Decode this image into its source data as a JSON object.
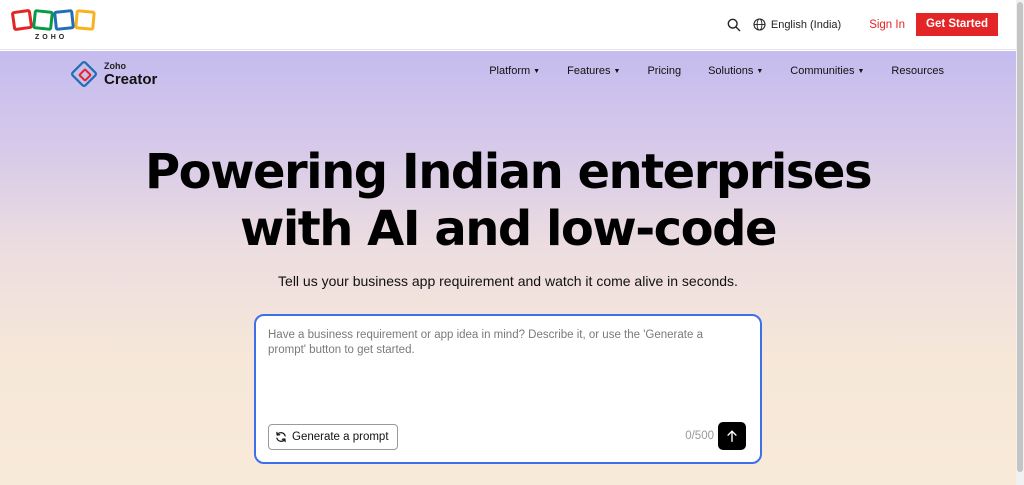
{
  "topbar": {
    "brand_word": "ZOHO",
    "language": "English (India)",
    "sign_in": "Sign In",
    "get_started": "Get Started"
  },
  "product": {
    "small": "Zoho",
    "big": "Creator"
  },
  "nav": {
    "items": [
      {
        "label": "Platform",
        "dropdown": true
      },
      {
        "label": "Features",
        "dropdown": true
      },
      {
        "label": "Pricing",
        "dropdown": false
      },
      {
        "label": "Solutions",
        "dropdown": true
      },
      {
        "label": "Communities",
        "dropdown": true
      },
      {
        "label": "Resources",
        "dropdown": false
      }
    ]
  },
  "hero": {
    "headline_line1": "Powering Indian enterprises",
    "headline_line2": "with AI and low-code",
    "subtitle": "Tell us your business app requirement and watch it come alive in seconds."
  },
  "prompt": {
    "placeholder": "Have a business requirement or app idea in mind? Describe it, or use the 'Generate a prompt' button to get started.",
    "generate_label": "Generate a prompt",
    "counter": "0/500"
  },
  "icons": {
    "search": "search-icon",
    "globe": "globe-icon",
    "refresh": "refresh-icon",
    "send": "arrow-up-icon"
  },
  "colors": {
    "accent_red": "#e42527",
    "prompt_border": "#3d6fe8",
    "logo_red": "#e42527",
    "logo_green": "#089949",
    "logo_blue": "#226db4",
    "logo_yellow": "#f9b21d"
  }
}
